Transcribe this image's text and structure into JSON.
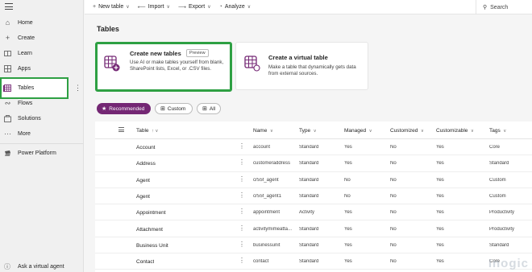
{
  "sidebar": {
    "items": [
      {
        "label": "Home",
        "icon": "home-icon"
      },
      {
        "label": "Create",
        "icon": "plus-icon"
      },
      {
        "label": "Learn",
        "icon": "book-icon"
      },
      {
        "label": "Apps",
        "icon": "apps-icon"
      },
      {
        "label": "Tables",
        "icon": "table-icon"
      },
      {
        "label": "Flows",
        "icon": "flow-icon"
      },
      {
        "label": "Solutions",
        "icon": "solutions-icon"
      },
      {
        "label": "More",
        "icon": "more-icon"
      }
    ],
    "platform": "Power Platform",
    "footer": "Ask a virtual agent"
  },
  "toolbar": {
    "new_table": "New table",
    "import": "Import",
    "export": "Export",
    "analyze": "Analyze",
    "search": "Search"
  },
  "main": {
    "title": "Tables",
    "cards": [
      {
        "title": "Create new tables",
        "badge": "Preview",
        "desc": "Use AI or make tables yourself from blank, SharePoint lists, Excel, or .CSV files."
      },
      {
        "title": "Create a virtual table",
        "desc": "Make a table that dynamically gets data from external sources."
      }
    ],
    "filters": {
      "recommended": "Recommended",
      "custom": "Custom",
      "all": "All"
    },
    "columns": {
      "table": "Table",
      "name": "Name",
      "type": "Type",
      "managed": "Managed",
      "customized": "Customized",
      "customizable": "Customizable",
      "tags": "Tags"
    },
    "rows": [
      {
        "table": "Account",
        "name": "account",
        "type": "Standard",
        "managed": "Yes",
        "customized": "No",
        "customizable": "Yes",
        "tags": "Core"
      },
      {
        "table": "Address",
        "name": "customeraddress",
        "type": "Standard",
        "managed": "Yes",
        "customized": "No",
        "customizable": "Yes",
        "tags": "Standard"
      },
      {
        "table": "Agent",
        "name": "cr55f_agent",
        "type": "Standard",
        "managed": "No",
        "customized": "No",
        "customizable": "Yes",
        "tags": "Custom"
      },
      {
        "table": "Agent",
        "name": "cr55f_agent1",
        "type": "Standard",
        "managed": "No",
        "customized": "No",
        "customizable": "Yes",
        "tags": "Custom"
      },
      {
        "table": "Appointment",
        "name": "appointment",
        "type": "Activity",
        "managed": "Yes",
        "customized": "No",
        "customizable": "Yes",
        "tags": "Productivity"
      },
      {
        "table": "Attachment",
        "name": "activitymimeatta...",
        "type": "Standard",
        "managed": "Yes",
        "customized": "No",
        "customizable": "Yes",
        "tags": "Productivity"
      },
      {
        "table": "Business Unit",
        "name": "businessunit",
        "type": "Standard",
        "managed": "Yes",
        "customized": "No",
        "customizable": "Yes",
        "tags": "Standard"
      },
      {
        "table": "Contact",
        "name": "contact",
        "type": "Standard",
        "managed": "Yes",
        "customized": "No",
        "customizable": "Yes",
        "tags": "Core"
      }
    ]
  },
  "watermark": "Inogic",
  "colors": {
    "accent": "#742774",
    "highlight": "#2ea043"
  }
}
